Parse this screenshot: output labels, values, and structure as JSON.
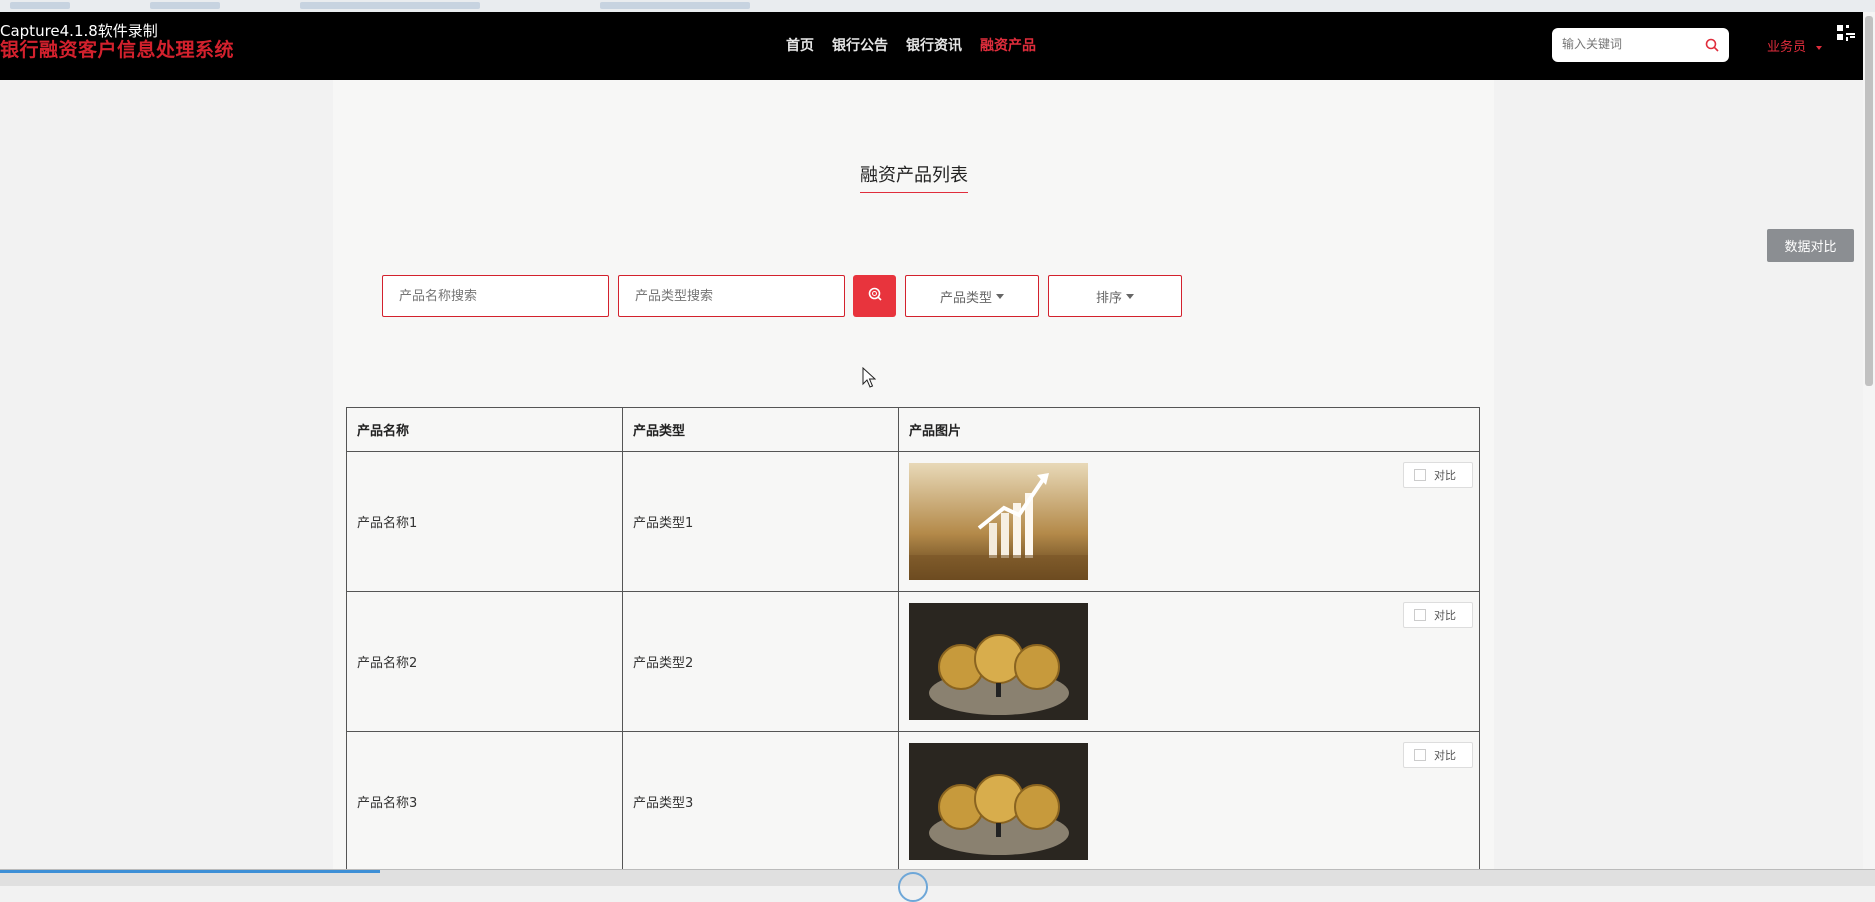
{
  "watermark": "Capture4.1.8软件录制",
  "header": {
    "logo": "银行融资客户信息处理系统",
    "nav": [
      {
        "label": "首页"
      },
      {
        "label": "银行公告"
      },
      {
        "label": "银行资讯"
      },
      {
        "label": "融资产品",
        "active": true
      }
    ],
    "search_placeholder": "输入关键词",
    "user_label": "业务员"
  },
  "page": {
    "title": "融资产品列表",
    "name_search_placeholder": "产品名称搜索",
    "type_search_placeholder": "产品类型搜索",
    "type_dropdown": "产品类型",
    "sort_dropdown": "排序",
    "compare_data_button": "数据对比"
  },
  "table": {
    "headers": [
      "产品名称",
      "产品类型",
      "产品图片"
    ],
    "compare_label": "对比",
    "rows": [
      {
        "name": "产品名称1",
        "type": "产品类型1",
        "image": "gold-finance-chart"
      },
      {
        "name": "产品名称2",
        "type": "产品类型2",
        "image": "bitcoin-coins"
      },
      {
        "name": "产品名称3",
        "type": "产品类型3",
        "image": "bitcoin-coins"
      }
    ]
  },
  "colors": {
    "accent": "#e02d3c",
    "topbar": "#000000",
    "button_gray": "#8b8e92"
  }
}
